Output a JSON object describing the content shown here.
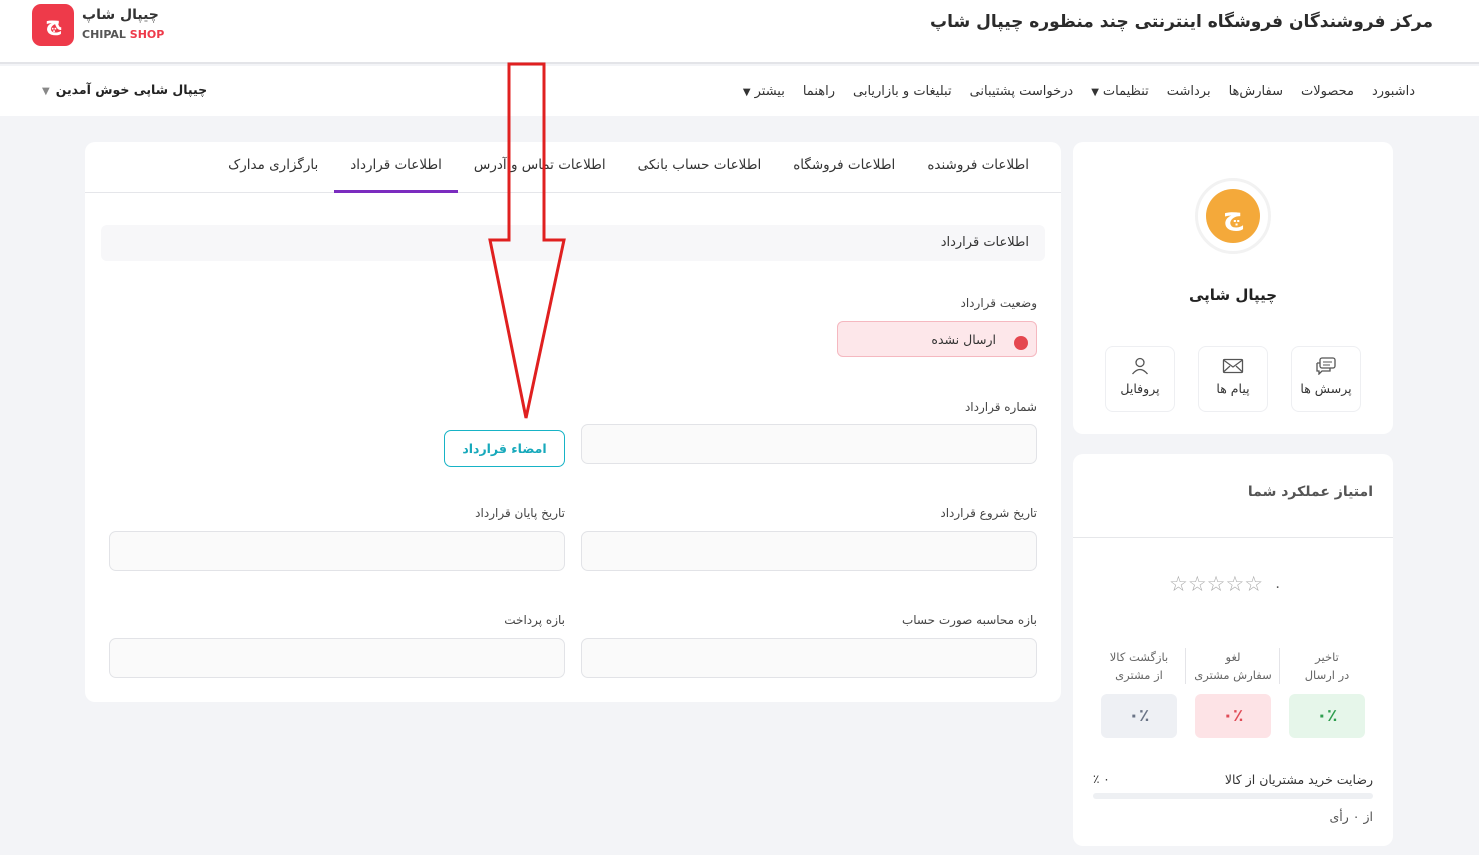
{
  "header": {
    "title": "مرکز فروشندگان فروشگاه اینترنتی چند منظوره چیپال شاپ",
    "logo_fa": "چیپال شاپ",
    "logo_en_1": "CHIPAL",
    "logo_en_2": "SHOP",
    "logo_mark": "ﭻ"
  },
  "nav": {
    "items": [
      {
        "label": "داشبورد"
      },
      {
        "label": "محصولات"
      },
      {
        "label": "سفارش‌ها"
      },
      {
        "label": "برداشت"
      },
      {
        "label": "تنظیمات"
      },
      {
        "label": "درخواست پشتیبانی"
      },
      {
        "label": "تبلیغات و بازاریابی"
      },
      {
        "label": "راهنما"
      },
      {
        "label": "بیشتر"
      }
    ],
    "welcome": "چیپال شاپی خوش آمدین"
  },
  "tabs": [
    {
      "label": "اطلاعات فروشنده"
    },
    {
      "label": "اطلاعات فروشگاه"
    },
    {
      "label": "اطلاعات حساب بانکی"
    },
    {
      "label": "اطلاعات تماس و آدرس"
    },
    {
      "label": "اطلاعات قرارداد"
    },
    {
      "label": "بارگزاری مدارک"
    }
  ],
  "form": {
    "section_title": "اطلاعات قرارداد",
    "status_label": "وضعیت قرارداد",
    "status_value": "ارسال نشده",
    "contract_number_label": "شماره قرارداد",
    "sign_button": "امضاء قرارداد",
    "start_date_label": "تاریخ شروع قرارداد",
    "end_date_label": "تاریخ پایان قرارداد",
    "billing_period_label": "بازه محاسبه صورت حساب",
    "payment_period_label": "بازه پرداخت"
  },
  "profile": {
    "avatar_letter": "چ",
    "store_name": "چیپال شاپی",
    "buttons": [
      {
        "label": "پرسش ها",
        "icon": "chat-icon"
      },
      {
        "label": "پیام ها",
        "icon": "mail-icon"
      },
      {
        "label": "پروفایل",
        "icon": "user-icon"
      }
    ]
  },
  "performance": {
    "title": "امتیاز عملکرد شما",
    "rating": 0,
    "rating_text": "۰",
    "stars_text": "☆☆☆☆☆",
    "metrics": [
      {
        "title_1": "تاخیر",
        "title_2": "در ارسال",
        "value": "۰٪",
        "bg": "#e6f6ea",
        "fg": "#2f9e4f"
      },
      {
        "title_1": "لغو",
        "title_2": "سفارش مشتری",
        "value": "۰٪",
        "bg": "#fde3e6",
        "fg": "#e04c58"
      },
      {
        "title_1": "بازگشت کالا",
        "title_2": "از مشتری",
        "value": "۰٪",
        "bg": "#eef0f4",
        "fg": "#6a7486"
      }
    ],
    "satisfaction_label": "رضایت خرید مشتریان از کالا",
    "satisfaction_value": "۰ ٪",
    "satisfaction_percent": 0,
    "votes": "از ۰ رأی"
  },
  "colors": {
    "accent": "#7b2cbf",
    "brand": "#ee3a4a",
    "button": "#17b3c6",
    "arrow": "#e02020"
  }
}
